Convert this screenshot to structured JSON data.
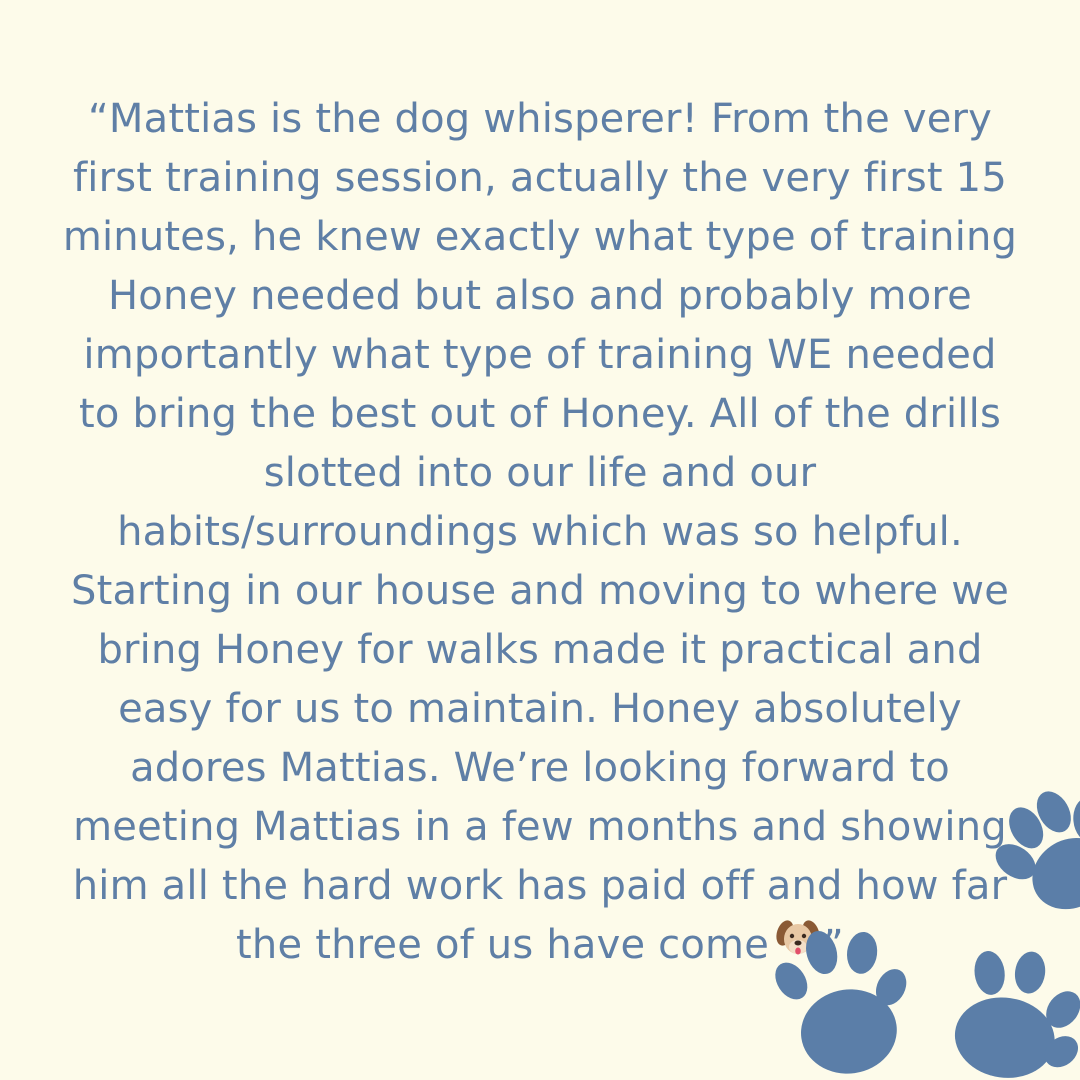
{
  "testimonial": {
    "lines": [
      "“Mattias is the dog whisperer! From the very",
      "first training session, actually the very first 15",
      "minutes, he knew exactly what type of training",
      "Honey needed but also and probably more",
      "importantly what type of training WE needed",
      "to bring the best out of Honey. All of the drills",
      "slotted into our life and our",
      "habits/surroundings which was so helpful.",
      "Starting in our house and moving to where we",
      "bring Honey for walks made it practical and",
      "easy for us to maintain. Honey absolutely",
      "adores Mattias. We’re looking forward to",
      "meeting Mattias in a few months and showing",
      "him all the hard work has paid off and how far"
    ],
    "last_line_text": "the three of us have come",
    "closing_quote": "”",
    "emoji_icon": "dog-face-icon"
  },
  "colors": {
    "background": "#fdfbea",
    "text": "#5f7fa6",
    "paw": "#5b7ea8"
  },
  "decorations": {
    "icons": [
      "paw-print-icon",
      "paw-print-icon",
      "paw-print-icon"
    ]
  }
}
